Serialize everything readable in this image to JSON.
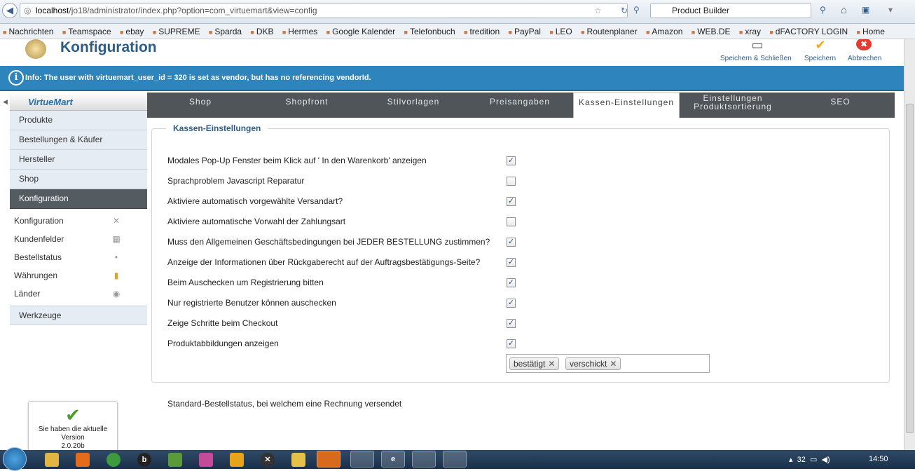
{
  "browser": {
    "url_host": "localhost",
    "url_path": "/jo18/administrator/index.php?option=com_virtuemart&view=config",
    "search_value": "Product Builder",
    "bookmarks": [
      "Nachrichten",
      "Teamspace",
      "ebay",
      "SUPREME",
      "Sparda",
      "DKB",
      "Hermes",
      "Google Kalender",
      "Telefonbuch",
      "tredition",
      "PayPal",
      "LEO",
      "Routenplaner",
      "Amazon",
      "WEB.DE",
      "xray",
      "dFACTORY LOGIN",
      "Home"
    ]
  },
  "header": {
    "title": "Konfiguration",
    "toolbar": {
      "save_close": "Speichern & Schließen",
      "save": "Speichern",
      "cancel": "Abbrechen"
    }
  },
  "info": {
    "text": "Info: The user with virtuemart_user_id = 320 is set as vendor, but has no referencing vendorId."
  },
  "sidebar": {
    "logo": "VirtueMart",
    "menu": [
      "Produkte",
      "Bestellungen & Käufer",
      "Hersteller",
      "Shop",
      "Konfiguration"
    ],
    "submenu": [
      "Konfiguration",
      "Kundenfelder",
      "Bestellstatus",
      "Währungen",
      "Länder"
    ],
    "tools": "Werkzeuge",
    "version": {
      "line1": "Sie haben die aktuelle",
      "line2": "Version",
      "number": "2.0.20b"
    }
  },
  "tabs": [
    "Shop",
    "Shopfront",
    "Stilvorlagen",
    "Preisangaben",
    "Kassen-Einstellungen",
    "Einstellungen Produktsortierung",
    "SEO"
  ],
  "active_tab_index": 4,
  "form": {
    "legend": "Kassen-Einstellungen",
    "rows": [
      {
        "label": "Modales Pop-Up Fenster beim Klick auf ' In den Warenkorb' anzeigen",
        "checked": true
      },
      {
        "label": "Sprachproblem Javascript Reparatur",
        "checked": false
      },
      {
        "label": "Aktiviere automatisch vorgewählte Versandart?",
        "checked": true
      },
      {
        "label": "Aktiviere automatische Vorwahl der Zahlungsart",
        "checked": false
      },
      {
        "label": "Muss den Allgemeinen Geschäftsbedingungen bei JEDER BESTELLUNG zustimmen?",
        "checked": true
      },
      {
        "label": "Anzeige der Informationen über Rückgaberecht auf der Auftragsbestätigungs-Seite?",
        "checked": true
      },
      {
        "label": "Beim Auschecken um Registrierung bitten",
        "checked": true
      },
      {
        "label": "Nur registrierte Benutzer können auschecken",
        "checked": true
      },
      {
        "label": "Zeige Schritte beim Checkout",
        "checked": true
      },
      {
        "label": "Produktabbildungen anzeigen",
        "checked": true
      }
    ],
    "status_label": "Standard-Bestellstatus, bei welchem eine Rechnung versendet",
    "status_values": [
      "bestätigt",
      "verschickt"
    ]
  },
  "taskbar": {
    "time": "14:50",
    "tray_value": "32"
  }
}
